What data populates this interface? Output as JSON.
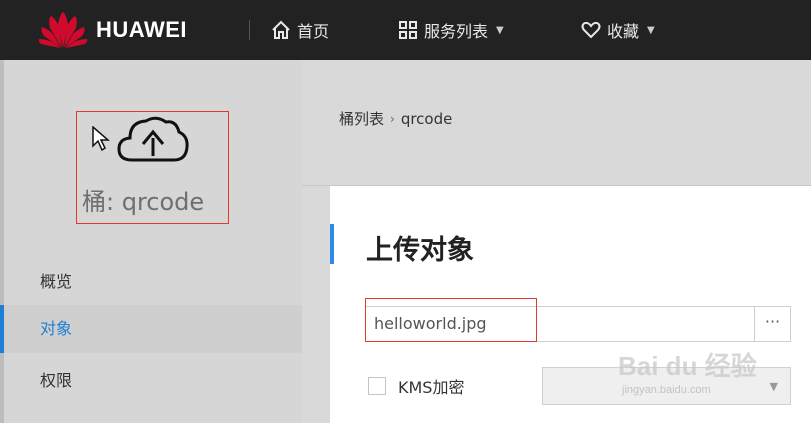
{
  "header": {
    "brand": "HUAWEI",
    "nav": {
      "home": "首页",
      "services": "服务列表",
      "favorites": "收藏"
    }
  },
  "sidebar": {
    "bucket_title": "桶: qrcode",
    "items": [
      {
        "label": "概览"
      },
      {
        "label": "对象",
        "active": true
      },
      {
        "label": "权限"
      }
    ]
  },
  "breadcrumb": {
    "root": "桶列表",
    "current": "qrcode"
  },
  "upload": {
    "title": "上传对象",
    "file_value": "helloworld.jpg",
    "browse_label": "···",
    "kms_label": "KMS加密",
    "kms_checked": false
  },
  "watermark": {
    "text": "Bai du 经验",
    "sub": "jingyan.baidu.com"
  },
  "colors": {
    "topbar": "#222222",
    "accent": "#1f7fd6",
    "highlight": "#e23a2e",
    "brand_red": "#cf0a2c"
  },
  "icons": {
    "logo": "huawei-petal-icon",
    "home": "home-icon",
    "services": "grid-icon",
    "favorites": "heart-icon",
    "cursor": "cursor-arrow-icon",
    "bucket": "cloud-upload-icon"
  }
}
